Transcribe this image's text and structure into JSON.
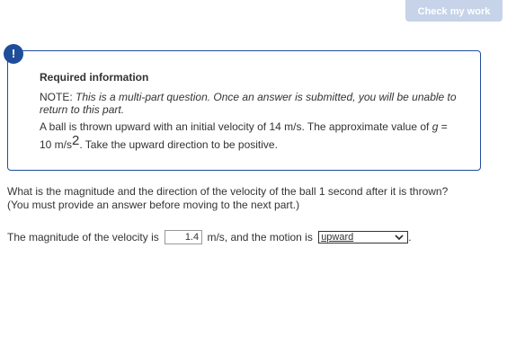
{
  "toolbar": {
    "check_label": "Check my work"
  },
  "info": {
    "alert_glyph": "!",
    "title": "Required information",
    "note_prefix": "NOTE:",
    "note_italic": "This is a multi-part question. Once an answer is submitted, you will be unable to return to this part.",
    "problem_a": "A ball is thrown upward with an initial velocity of 14 m/s. The approximate value of",
    "problem_var": "g",
    "problem_b": "= 10 m/s",
    "problem_sup": "2",
    "problem_c": ". Take the upward direction to be positive."
  },
  "question": {
    "text": "What is the magnitude and the direction of the velocity of the ball 1 second after it is thrown? (You must provide an answer before moving to the next part.)"
  },
  "answer": {
    "prefix": "The magnitude of the velocity is",
    "velocity_value": "1.4",
    "middle": "m/s, and the motion is",
    "direction_selected": "upward",
    "suffix": "."
  },
  "icons": {
    "alert": "exclamation-circle-icon",
    "dropdown": "chevron-down-icon"
  },
  "colors": {
    "accent": "#1f4d9a",
    "button_disabled": "#c6d3e8",
    "text": "#333333"
  }
}
